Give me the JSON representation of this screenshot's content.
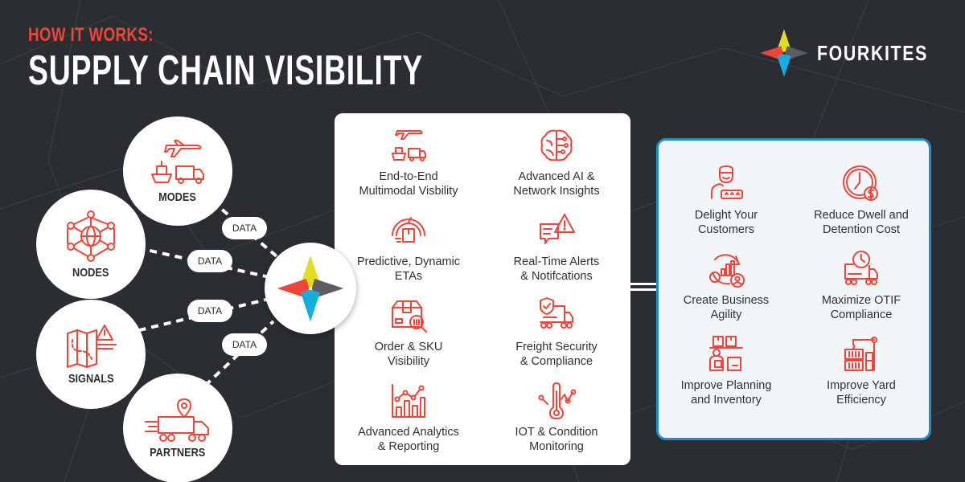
{
  "header": {
    "eyebrow": "HOW IT WORKS:",
    "title": "SUPPLY CHAIN VISIBILITY"
  },
  "brand": {
    "name": "FOURKITES",
    "logo_icon": "four-point-kite-star",
    "colors": {
      "top": "#e2dd1e",
      "left": "#f04438",
      "right": "#5a5d62",
      "bottom": "#15aedc"
    }
  },
  "sources": [
    {
      "id": "modes",
      "label": "MODES",
      "icon": "plane-ship-truck-icon"
    },
    {
      "id": "nodes",
      "label": "NODES",
      "icon": "globe-network-icon"
    },
    {
      "id": "signals",
      "label": "SIGNALS",
      "icon": "map-alert-icon"
    },
    {
      "id": "partners",
      "label": "PARTNERS",
      "icon": "truck-location-icon"
    }
  ],
  "connector_label": "DATA",
  "data_pills": [
    "DATA",
    "DATA",
    "DATA",
    "DATA"
  ],
  "features": [
    {
      "label": "End-to-End\nMultimodal Visbility",
      "icon": "multimodal-icon"
    },
    {
      "label": "Advanced AI &\nNetwork Insights",
      "icon": "ai-brain-icon"
    },
    {
      "label": "Predictive, Dynamic\nETAs",
      "icon": "speedometer-package-icon"
    },
    {
      "label": "Real-Time Alerts\n& Notifcations",
      "icon": "chat-alert-icon"
    },
    {
      "label": "Order & SKU\nVisibility",
      "icon": "box-search-icon"
    },
    {
      "label": "Freight Security\n& Compliance",
      "icon": "shield-truck-icon"
    },
    {
      "label": "Advanced Analytics\n& Reporting",
      "icon": "bar-line-chart-icon"
    },
    {
      "label": "IOT & Condition\nMonitoring",
      "icon": "thermometer-graph-icon"
    }
  ],
  "benefits": [
    {
      "label": "Delight Your\nCustomers",
      "icon": "customer-rating-icon"
    },
    {
      "label": "Reduce Dwell and\nDetention Cost",
      "icon": "clock-dollar-icon"
    },
    {
      "label": "Create Business\nAgility",
      "icon": "agility-cycle-icon"
    },
    {
      "label": "Maximize OTIF\nCompliance",
      "icon": "truck-clock-icon"
    },
    {
      "label": "Improve Planning\nand Inventory",
      "icon": "warehouse-worker-icon"
    },
    {
      "label": "Improve Yard\nEfficiency",
      "icon": "crane-containers-icon"
    }
  ],
  "accent_color": "#f04438",
  "benefits_border_color": "#1a8fd0"
}
